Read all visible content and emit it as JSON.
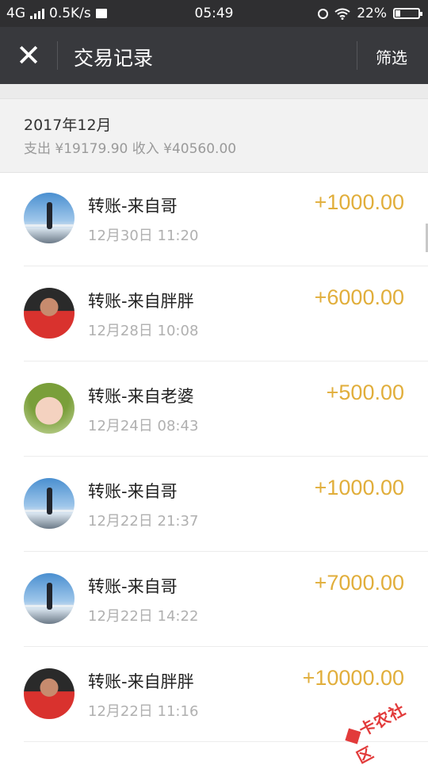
{
  "status": {
    "network": "4G",
    "speed": "0.5K/s",
    "time": "05:49",
    "battery_percent_text": "22%",
    "battery_level": 0.22
  },
  "nav": {
    "close_glyph": "✕",
    "title": "交易记录",
    "filter_label": "筛选"
  },
  "month": {
    "title": "2017年12月",
    "summary": "支出 ¥19179.90 收入 ¥40560.00"
  },
  "transactions": [
    {
      "title": "转账-来自哥",
      "time": "12月30日 11:20",
      "amount": "+1000.00",
      "avatar": "sky"
    },
    {
      "title": "转账-来自胖胖",
      "time": "12月28日 10:08",
      "amount": "+6000.00",
      "avatar": "red"
    },
    {
      "title": "转账-来自老婆",
      "time": "12月24日 08:43",
      "amount": "+500.00",
      "avatar": "baby"
    },
    {
      "title": "转账-来自哥",
      "time": "12月22日 21:37",
      "amount": "+1000.00",
      "avatar": "sky"
    },
    {
      "title": "转账-来自哥",
      "time": "12月22日 14:22",
      "amount": "+7000.00",
      "avatar": "sky"
    },
    {
      "title": "转账-来自胖胖",
      "time": "12月22日 11:16",
      "amount": "+10000.00",
      "avatar": "red"
    }
  ],
  "watermark": "卡农社区",
  "colors": {
    "nav_bg": "#38393d",
    "amount": "#e1ae3b"
  }
}
